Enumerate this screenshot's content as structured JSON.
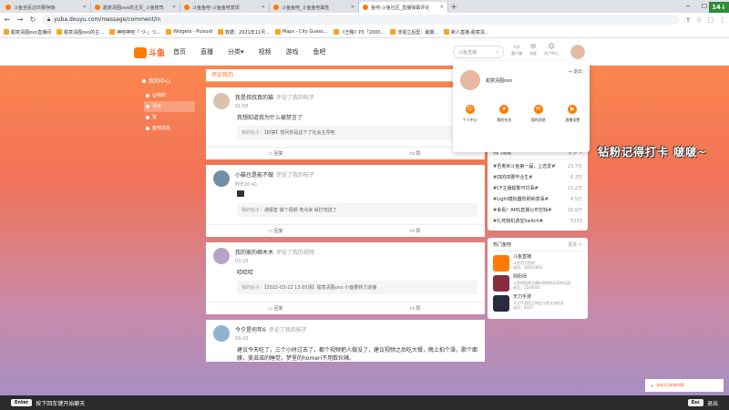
{
  "browser": {
    "tabs": [
      {
        "title": "斗鱼全民达匹赛存储-",
        "active": false
      },
      {
        "title": "甜意清囿ovo的主页_斗鱼搜司",
        "active": false
      },
      {
        "title": "斗鱼鱼吧-斗鱼鱼吧发现",
        "active": false
      },
      {
        "title": "斗鱼鱼吧_斗鱼鱼吧属性",
        "active": false
      },
      {
        "title": "鱼吧-斗鱼社区_直播弹幕评论",
        "active": true
      }
    ],
    "url": "yuba.douyu.com/message/comment/in",
    "bookmarks": [
      "甜意清囿ovo直播间",
      "甜意清囿ovo的主...",
      "神吧神吧「 づ-」つ...",
      "Widgets - Pulsoid",
      "数据：2021年11月...",
      "Maps - City Guess...",
      "《王略》P3「2000...",
      "非视立后型：最期...",
      "新人直播-甜意清..."
    ]
  },
  "site": {
    "logo_text": "斗鱼",
    "nav": [
      "首页",
      "直播",
      "分类▾",
      "视频",
      "游戏",
      "鱼吧"
    ],
    "search_placeholder": "斗鱼直播",
    "top_icons": [
      "客户端",
      "消息",
      "开户中心"
    ]
  },
  "sidebar": {
    "title": "我的中心",
    "items": [
      {
        "label": "@我的",
        "active": false
      },
      {
        "label": "评论",
        "active": true
      },
      {
        "label": "赞",
        "active": false
      },
      {
        "label": "鱼吧消息",
        "active": false
      }
    ]
  },
  "main": {
    "tab_label": "评论我的",
    "comments": [
      {
        "user": "我是叔叔真的猫",
        "action": "评论了我的帖子",
        "time": "01:58",
        "text": "我想知道我为什么被禁言了",
        "quote_prefix": "我的帖子：",
        "quote": "【封禁】想问你是这下了社会主导吧",
        "reply_label": "回复",
        "like_label": "赞",
        "avatar_color": "#d9c3b0"
      },
      {
        "user": "小猫也是能不做",
        "action": "评论了我的帖子",
        "time": "昨天20:41",
        "text": "",
        "quote_prefix": "我的帖子：",
        "quote": "通报签 做个视频 地点来 就打地送了",
        "reply_label": "回复",
        "like_label": "赞",
        "avatar_color": "#6f8fa8"
      },
      {
        "user": "我的家的柳木木",
        "action": "评论了我的视频",
        "time": "03-25",
        "text": "哈哈哈",
        "quote_prefix": "我的帖子：",
        "quote": "【2022-03-22 13:05场】甜意清囿ovo 小面要转力道播",
        "reply_label": "回复",
        "like_label": "赞",
        "avatar_color": "#b6a4c8"
      },
      {
        "user": "今夕是何年6",
        "action": "评论了我的帖子",
        "time": "03-23",
        "text": "建议今天吃了，三个小时过去了，都个视频把人做没了，建议视频之后吃大餐，晚上拍个澡，歌个面膜，美滋滋的睡觉，梦里的homeri不用数伙辣。",
        "quote_prefix": "",
        "quote": "",
        "reply_label": "",
        "like_label": "",
        "avatar_color": "#8fb3cf"
      }
    ]
  },
  "dropdown": {
    "username": "甜意清囿ovo",
    "logout": "退出",
    "items": [
      "个人中心",
      "我的任务",
      "我的消息",
      "直播设置"
    ]
  },
  "hot_topics": {
    "title": "热门话题",
    "more": "更多 >",
    "rows": [
      {
        "name": "#吾奥米斗鱼第一届，上恋爱#",
        "count": "23.7万"
      },
      {
        "name": "#四的四要毕业生#",
        "count": "6.3万"
      },
      {
        "name": "#CF主播超繁可坑事#",
        "count": "15.2万"
      },
      {
        "name": "#Light模拟器防刷纳意事#",
        "count": "4.5万"
      },
      {
        "name": "#来看！AMS直播公布空缺#",
        "count": "16.9万"
      },
      {
        "name": "#扎死我机游显Switch#",
        "count": "5333"
      }
    ]
  },
  "hot_bars": {
    "title": "热门鱼吧",
    "more": "更多 >",
    "rows": [
      {
        "name": "斗鱼直播",
        "desc": "斗鱼官方鱼吧",
        "count": "成员：48023883",
        "color": "#ff7a00"
      },
      {
        "name": "阴阳师",
        "desc": "斗鱼阴阳师主播&阴阳师玩家的乐园",
        "count": "成员：1500000",
        "color": "#8a2c3c"
      },
      {
        "name": "天刀手游",
        "desc": "天刀手游官方指定斗鱼交流社区",
        "count": "成员：9327",
        "color": "#2a2a40"
      }
    ]
  },
  "overlay": {
    "stream_text": "钻粉记得打卡 啵啵~",
    "corner_badge": "14↓",
    "gift_bar": "送给1位新来的哦"
  },
  "chat": {
    "enter_key": "Enter",
    "enter_hint": "按下回车键开始聊天",
    "esc_key": "Esc",
    "esc_hint": "退出"
  },
  "colors": {
    "brand": "#ff7a00",
    "accent": "#ff6a2a"
  }
}
